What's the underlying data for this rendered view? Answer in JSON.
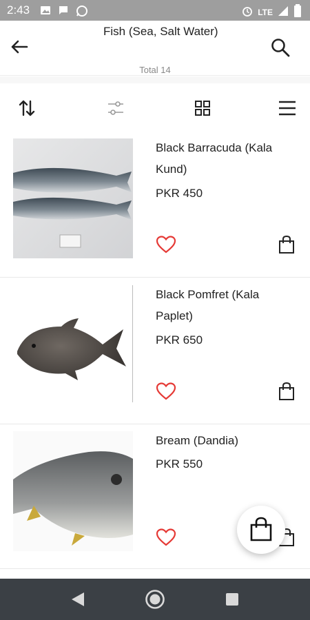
{
  "status_bar": {
    "time": "2:43",
    "network": "LTE",
    "icons": [
      "image-icon",
      "message-icon",
      "whatsapp-icon",
      "alarm-icon",
      "signal-icon",
      "battery-icon"
    ]
  },
  "header": {
    "title": "Fish (Sea, Salt Water)",
    "total": "Total 14"
  },
  "toolbar": {
    "icons": [
      "sort-icon",
      "filter-icon",
      "grid-view-icon",
      "menu-icon"
    ]
  },
  "products": [
    {
      "name": "Black Barracuda (Kala Kund)",
      "price": "PKR 450",
      "image": "fish-barracuda-image"
    },
    {
      "name": "Black Pomfret (Kala Paplet)",
      "price": "PKR 650",
      "image": "fish-pomfret-image"
    },
    {
      "name": "Bream (Dandia)",
      "price": "PKR 550",
      "image": "fish-bream-image"
    }
  ],
  "colors": {
    "heart": "#e53935",
    "status_bar": "#9e9e9e",
    "nav_bar": "#3b4045"
  },
  "nav_bar": {
    "icons": [
      "back-triangle-icon",
      "home-circle-icon",
      "recents-square-icon"
    ]
  }
}
